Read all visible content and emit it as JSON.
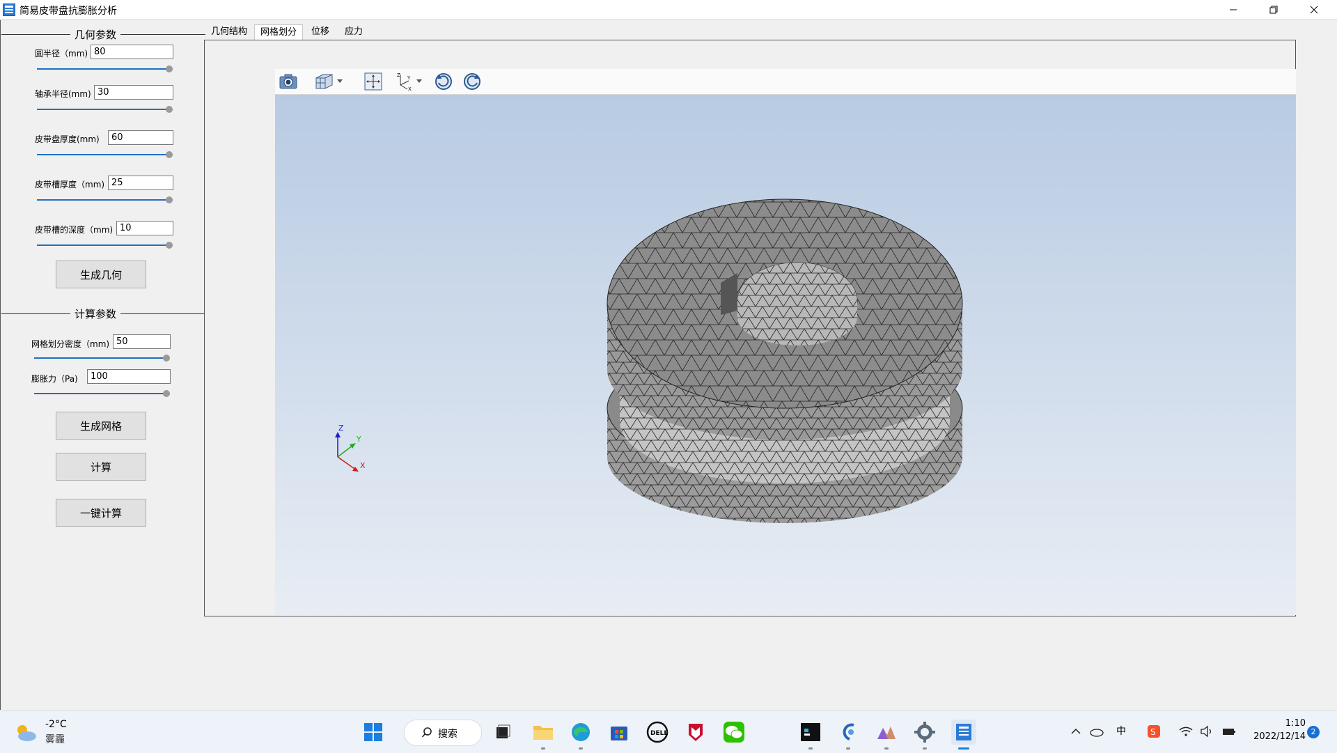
{
  "window": {
    "title": "简易皮带盘抗膨胀分析"
  },
  "geometry_params": {
    "title": "几何参数",
    "fields": [
      {
        "label": "圆半径（mm)",
        "value": "80"
      },
      {
        "label": "轴承半径(mm)",
        "value": "30"
      },
      {
        "label": "皮带盘厚度(mm)",
        "value": "60"
      },
      {
        "label": "皮带槽厚度（mm)",
        "value": "25"
      },
      {
        "label": "皮带槽的深度（mm)",
        "value": "10"
      }
    ],
    "generate_button": "生成几何"
  },
  "calc_params": {
    "title": "计算参数",
    "fields": [
      {
        "label": "网格划分密度（mm)",
        "value": "50"
      },
      {
        "label": "膨胀力（Pa)",
        "value": "100"
      }
    ],
    "mesh_button": "生成网格",
    "compute_button": "计算",
    "one_click_button": "一键计算"
  },
  "tabs": [
    {
      "label": "几何结构",
      "active": false
    },
    {
      "label": "网格划分",
      "active": true
    },
    {
      "label": "位移",
      "active": false
    },
    {
      "label": "应力",
      "active": false
    }
  ],
  "viewer": {
    "toolbar": [
      "camera-icon",
      "view-cube-icon",
      "fit-view-icon",
      "axes-orientation-icon",
      "rotate-cw-icon",
      "rotate-ccw-icon"
    ],
    "axes": {
      "z": "Z",
      "y": "Y",
      "x": "X"
    },
    "background_top": "#b8cbe3",
    "background_bottom": "#e8edf4",
    "mesh_fill": "#8a8a8a"
  },
  "taskbar": {
    "weather": {
      "temp": "-2°C",
      "condition": "雾霾"
    },
    "search_label": "搜索",
    "clock": {
      "time": "1:10",
      "date": "2022/12/14"
    },
    "notification_count": "2",
    "ime_label": "中",
    "apps": [
      "start-icon",
      "search",
      "task-view-icon",
      "file-explorer-icon",
      "edge-icon",
      "store-icon",
      "dell-icon",
      "mcafee-icon",
      "wechat-icon",
      "terminal-icon",
      "app-s-icon",
      "app-chart-icon",
      "settings-icon",
      "this-app-icon"
    ]
  }
}
